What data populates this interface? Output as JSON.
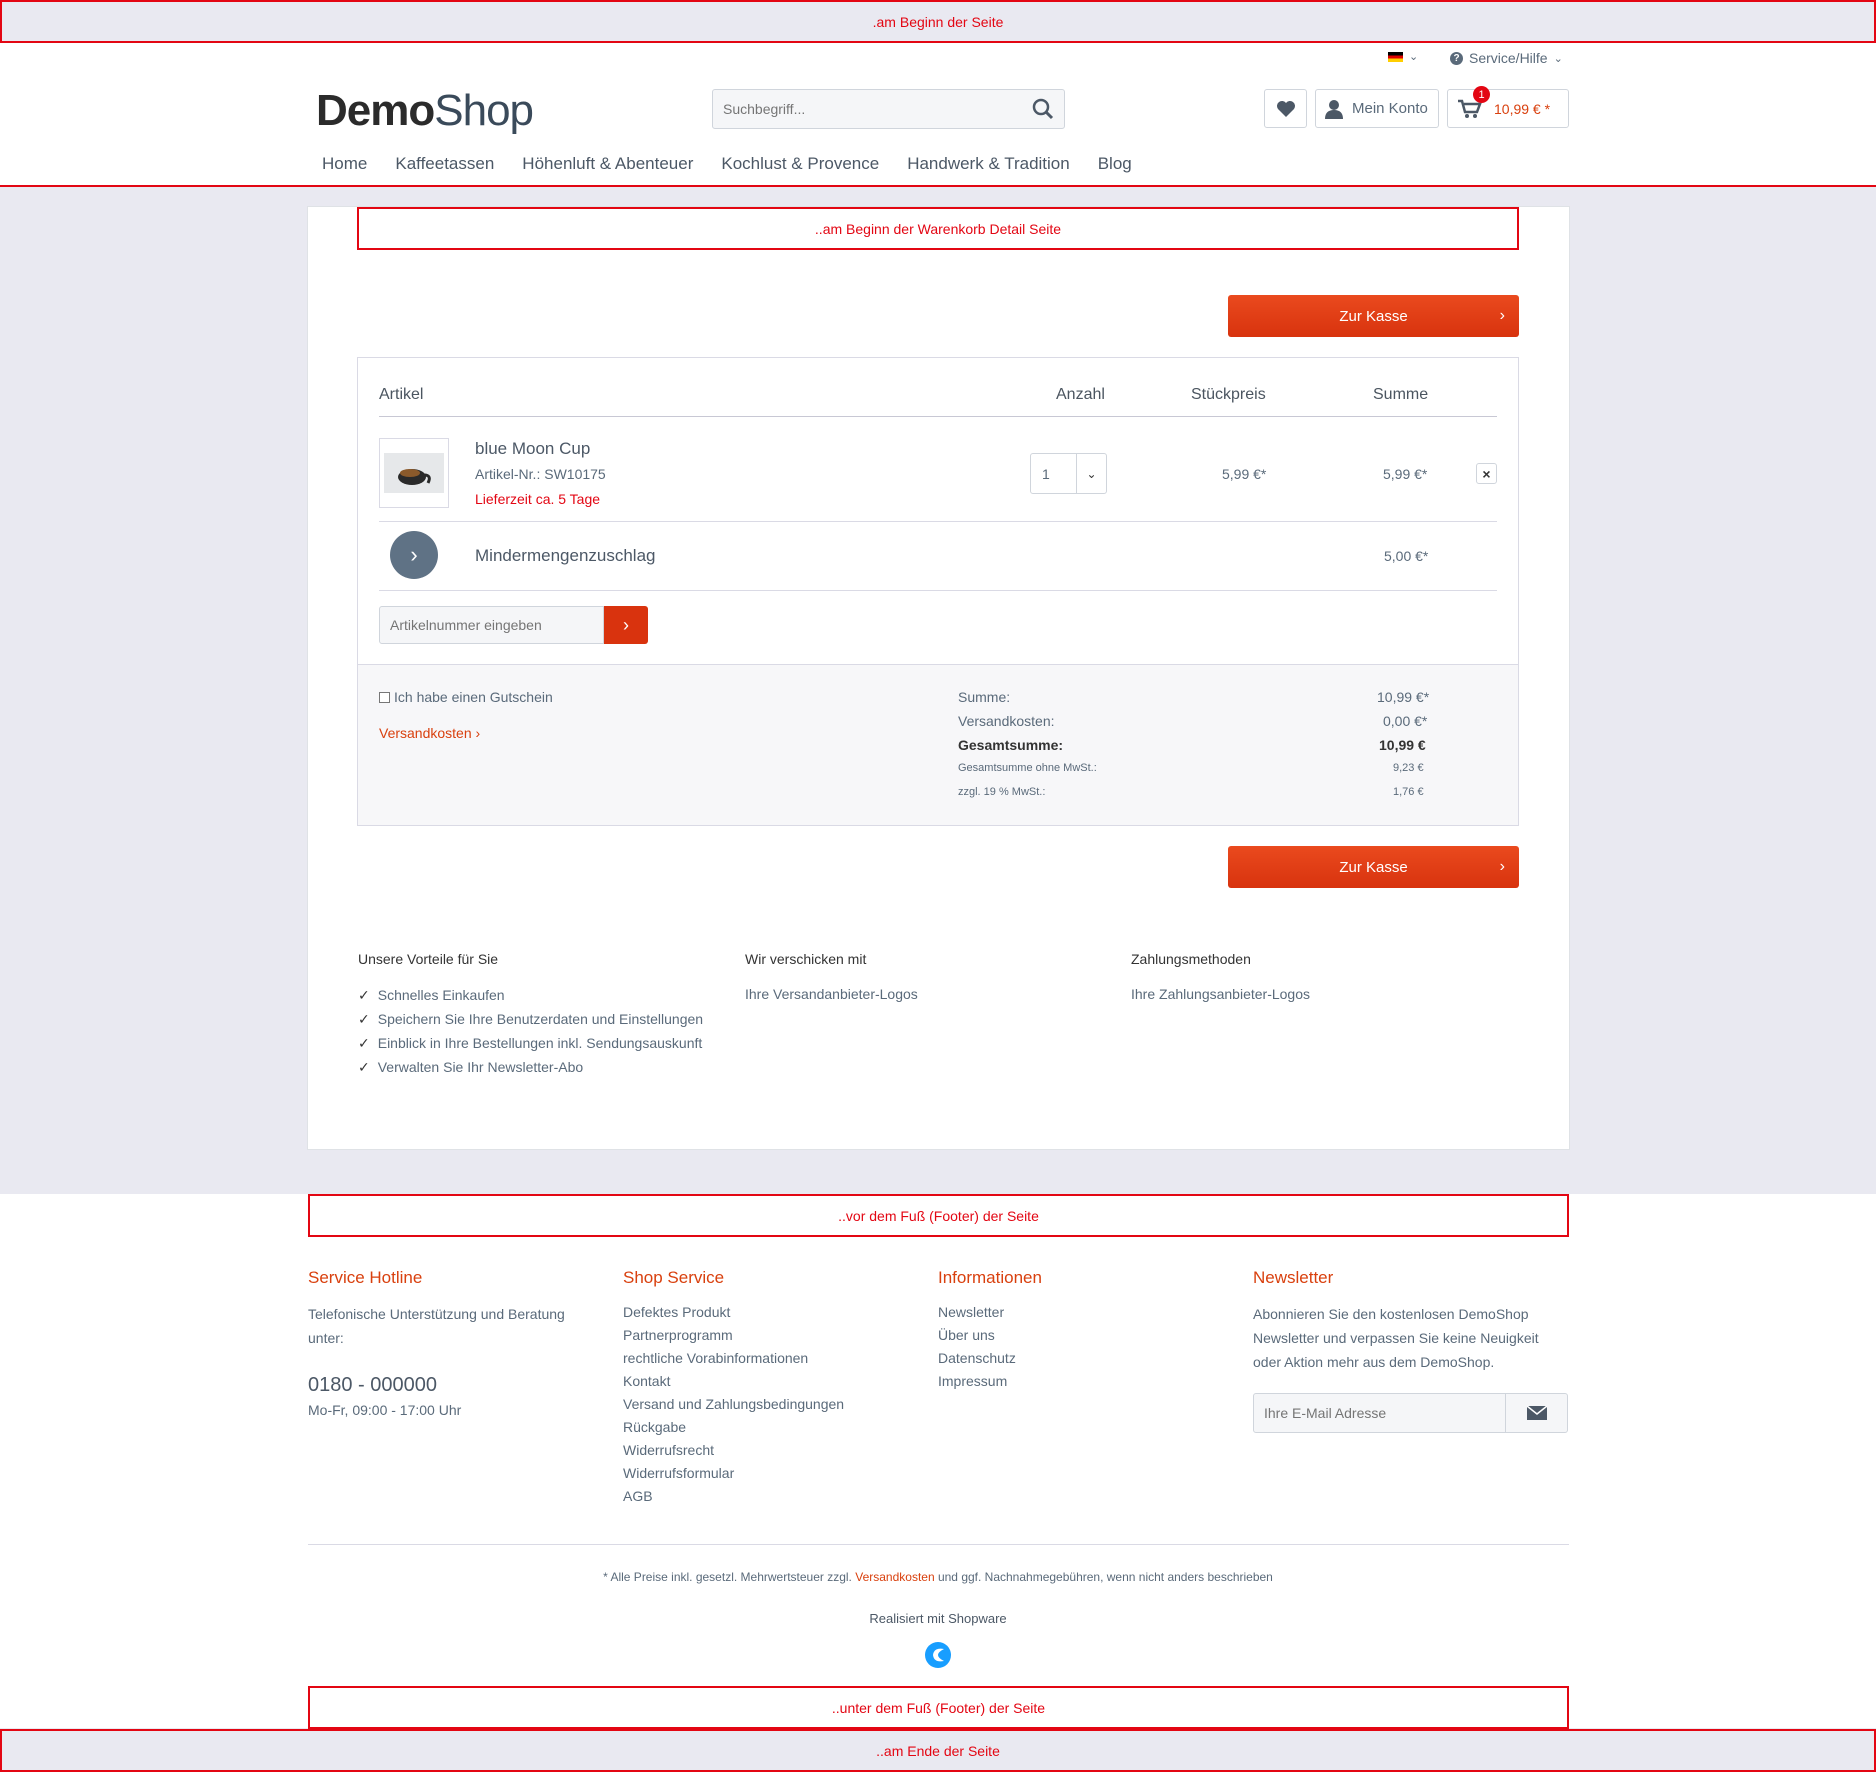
{
  "markers": {
    "page_start": ".am Beginn der Seite",
    "cart_start": "..am Beginn der Warenkorb Detail Seite",
    "before_footer": "..vor dem Fuß (Footer) der Seite",
    "below_footer": "..unter dem Fuß (Footer) der Seite",
    "page_end": "..am Ende der Seite"
  },
  "topbar": {
    "service": "Service/Hilfe"
  },
  "logo": {
    "bold": "Demo",
    "light": "Shop"
  },
  "search": {
    "placeholder": "Suchbegriff..."
  },
  "header": {
    "account": "Mein Konto",
    "cart_total": "10,99 € *",
    "cart_count": "1"
  },
  "nav": [
    "Home",
    "Kaffeetassen",
    "Höhenluft & Abenteuer",
    "Kochlust & Provence",
    "Handwerk & Tradition",
    "Blog"
  ],
  "checkout_label": "Zur Kasse",
  "table": {
    "col_article": "Artikel",
    "col_qty": "Anzahl",
    "col_unit": "Stückpreis",
    "col_sum": "Summe"
  },
  "item": {
    "name": "blue Moon Cup",
    "sku": "Artikel-Nr.: SW10175",
    "delivery": "Lieferzeit ca. 5 Tage",
    "qty": "1",
    "unit_price": "5,99 €*",
    "total": "5,99 €*"
  },
  "surcharge": {
    "name": "Mindermengenzuschlag",
    "total": "5,00 €*"
  },
  "add_article": {
    "placeholder": "Artikelnummer eingeben"
  },
  "voucher": {
    "label": "Ich habe einen Gutschein"
  },
  "shipping_link": "Versandkosten",
  "totals": {
    "sum_label": "Summe:",
    "sum": "10,99 €*",
    "ship_label": "Versandkosten:",
    "ship": "0,00 €*",
    "grand_label": "Gesamtsumme:",
    "grand": "10,99 €",
    "net_label": "Gesamtsumme ohne MwSt.:",
    "net": "9,23 €",
    "vat_label": "zzgl. 19 % MwSt.:",
    "vat": "1,76 €"
  },
  "benefits": {
    "title": "Unsere Vorteile für Sie",
    "items": [
      "Schnelles Einkaufen",
      "Speichern Sie Ihre Benutzerdaten und Einstellungen",
      "Einblick in Ihre Bestellungen inkl. Sendungsauskunft",
      "Verwalten Sie Ihr Newsletter-Abo"
    ]
  },
  "shipping_with": {
    "title": "Wir verschicken mit",
    "text": "Ihre Versandanbieter-Logos"
  },
  "payment": {
    "title": "Zahlungsmethoden",
    "text": "Ihre Zahlungsanbieter-Logos"
  },
  "footer": {
    "hotline": {
      "title": "Service Hotline",
      "text": "Telefonische Unterstützung und Beratung unter:",
      "phone": "0180 - 000000",
      "hours": "Mo-Fr, 09:00 - 17:00 Uhr"
    },
    "service": {
      "title": "Shop Service",
      "links": [
        "Defektes Produkt",
        "Partnerprogramm",
        "rechtliche Vorabinformationen",
        "Kontakt",
        "Versand und Zahlungsbedingungen",
        "Rückgabe",
        "Widerrufsrecht",
        "Widerrufsformular",
        "AGB"
      ]
    },
    "info": {
      "title": "Informationen",
      "links": [
        "Newsletter",
        "Über uns",
        "Datenschutz",
        "Impressum"
      ]
    },
    "newsletter": {
      "title": "Newsletter",
      "text": "Abonnieren Sie den kostenlosen DemoShop Newsletter und verpassen Sie keine Neuigkeit oder Aktion mehr aus dem DemoShop.",
      "placeholder": "Ihre E-Mail Adresse"
    },
    "vat_note_pre": "* Alle Preise inkl. gesetzl. Mehrwertsteuer zzgl. ",
    "vat_note_link": "Versandkosten",
    "vat_note_post": " und ggf. Nachnahmegebühren, wenn nicht anders beschrieben",
    "powered": "Realisiert mit Shopware"
  },
  "colors": {
    "accent": "#d9400e",
    "marker": "#e30613",
    "bg": "#e9e9f1"
  }
}
